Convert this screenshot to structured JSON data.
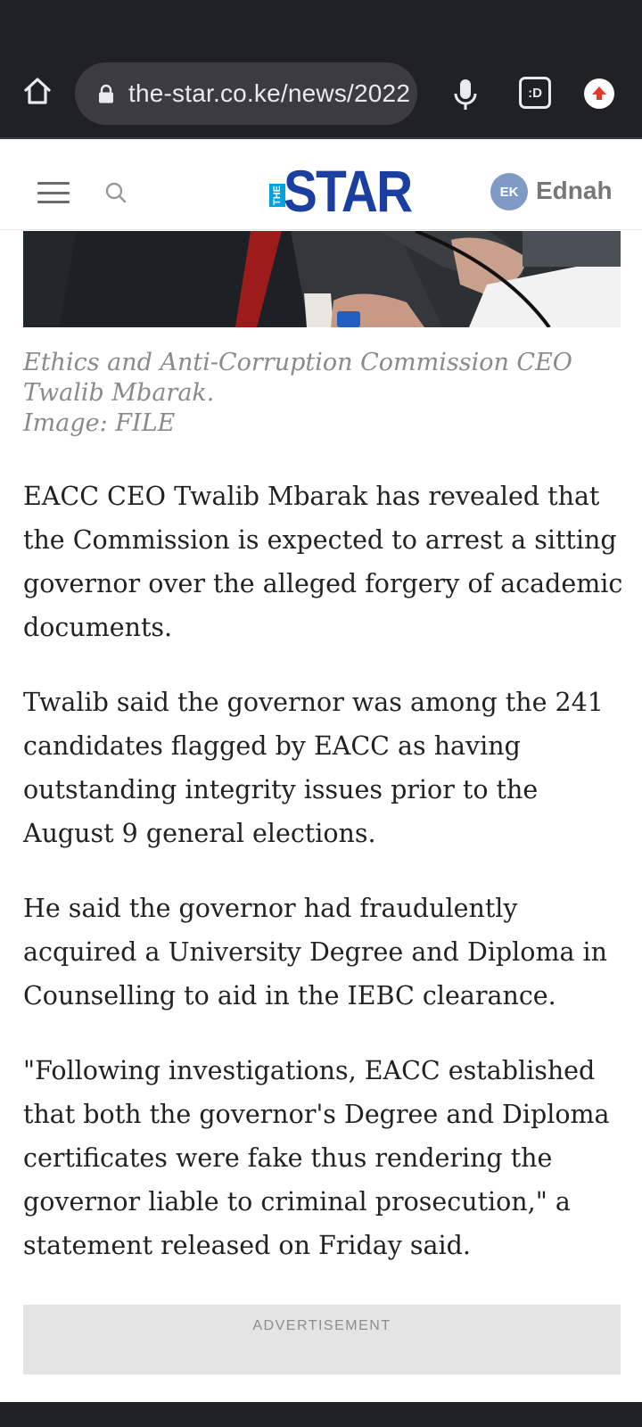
{
  "browser": {
    "url": "the-star.co.ke/news/2022",
    "tabs_label": ":D"
  },
  "site_header": {
    "logo_small": "THE",
    "logo_main": "STAR",
    "user_initials": "EK",
    "user_name": "Ednah"
  },
  "article": {
    "caption_lines": [
      "Ethics and Anti-Corruption Commission CEO",
      "Twalib Mbarak.",
      "Image: FILE"
    ],
    "paragraphs": [
      "EACC CEO Twalib Mbarak has revealed that the Commission is expected to arrest a sitting governor over the alleged forgery of academic documents.",
      "Twalib said the governor was among the 241 candidates flagged by EACC as having outstanding integrity issues prior to the August 9 general elections.",
      "He said the governor had fraudulently acquired a University Degree and Diploma in Counselling to aid in the IEBC clearance.",
      "\"Following investigations, EACC established that both the governor's Degree and Diploma certificates were fake thus rendering the governor liable to criminal prosecution,\" a statement released on Friday said."
    ],
    "ad_label": "ADVERTISEMENT"
  },
  "colors": {
    "logo_blue": "#1a3fa0",
    "logo_cyan": "#00a3e0",
    "avatar_bg": "#7f9ac4",
    "chrome_bg": "#202124"
  }
}
